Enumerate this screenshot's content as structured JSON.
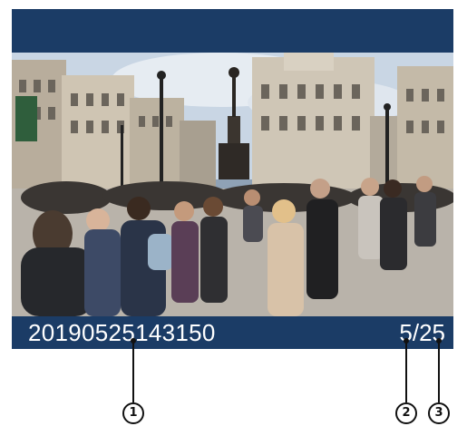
{
  "playback": {
    "file_number": "20190525143150",
    "current_image": "5",
    "separator": "/",
    "total_images": "25",
    "photo_subject": "street-crowd-photo"
  },
  "callouts": [
    {
      "number": "1",
      "target": "file-number"
    },
    {
      "number": "2",
      "target": "current-image-number"
    },
    {
      "number": "3",
      "target": "total-images"
    }
  ],
  "colors": {
    "screen_background": "#1b3c66",
    "text": "#ffffff",
    "callout": "#111111"
  }
}
